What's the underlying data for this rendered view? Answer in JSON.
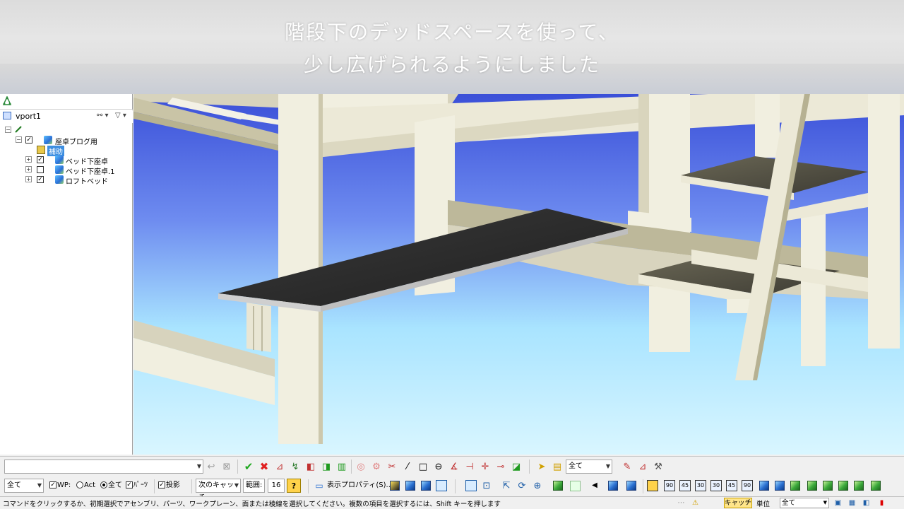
{
  "caption": {
    "line1": "階段下のデッドスペースを使って、",
    "line2": "少し広げられるようにしました"
  },
  "tree": {
    "viewport_label": "vport1",
    "items": [
      {
        "label": "座卓ブログ用",
        "checked": true,
        "expander": "⊟"
      },
      {
        "label": "補助",
        "selected": true
      },
      {
        "label": "ベッド下座卓",
        "checked": true,
        "expander": "⊞"
      },
      {
        "label": "ベッド下座卓.1",
        "checked": false,
        "expander": "⊞"
      },
      {
        "label": "ロフトベッド",
        "checked": true,
        "expander": "⊞"
      }
    ],
    "icons": {
      "tab": "assembly-tree-icon",
      "binoculars": "binoculars-icon",
      "filter": "filter-icon"
    }
  },
  "toolbar1": {
    "command_input_value": "",
    "filter_combo": "全て"
  },
  "toolbar2": {
    "select_scope": "全て",
    "wp_label": "WP:",
    "act_label": "Act",
    "all_label": "全て",
    "part_label": "ﾊﾟｰﾂ",
    "projection_label": "投影",
    "next_catch": "次のキャッチ",
    "range_label": "範囲:",
    "range_value": "16",
    "display_props": "表示プロパティ(S)...",
    "angle_buttons": [
      "90",
      "45",
      "30",
      "30",
      "45",
      "90"
    ]
  },
  "status": {
    "message": "コマンドをクリックするか、初期選択でアセンブリ、パーツ、ワークプレーン、面または稜線を選択してください。複数の項目を選択するには、Shift キーを押します",
    "catch_label": "キャッチ",
    "unit_label": "単位",
    "unit_value": "全て"
  },
  "colors": {
    "sky_top": "#3a4fd8",
    "sky_bottom": "#d9f6ff",
    "frame": "#f1efe0",
    "frame_shadow": "#bdb89a",
    "desk_top": "#2f2f2f",
    "step": "#55534a",
    "catch_highlight": "#ffe58a"
  }
}
